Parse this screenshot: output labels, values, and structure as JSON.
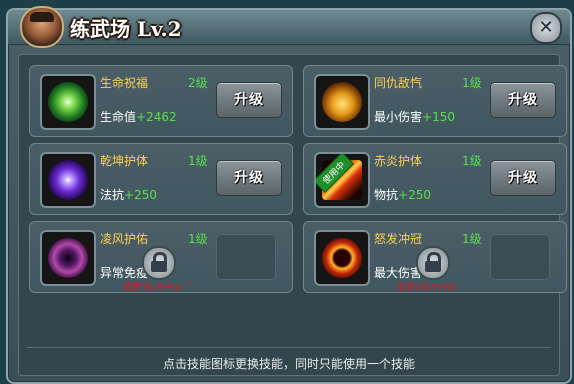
{
  "title": "练武场 Lv.2",
  "close_icon_glyph": "✕",
  "skills": [
    {
      "name": "生命祝福",
      "level": "2级",
      "stat_label": "生命值",
      "stat_bonus": "+2462",
      "button": "升级",
      "icon": "green-lotus-icon"
    },
    {
      "name": "同仇敌忾",
      "level": "1级",
      "stat_label": "最小伤害",
      "stat_bonus": "+150",
      "button": "升级",
      "icon": "golden-dragon-icon"
    },
    {
      "name": "乾坤护体",
      "level": "1级",
      "stat_label": "法抗",
      "stat_bonus": "+250",
      "button": "升级",
      "icon": "purple-vortex-icon"
    },
    {
      "name": "赤炎护体",
      "level": "1级",
      "stat_label": "物抗",
      "stat_bonus": "+250",
      "button": "升级",
      "icon": "fire-sword-icon",
      "badge": "使用中"
    },
    {
      "name": "凌风护佑",
      "level": "1级",
      "stat_label": "异常免疫",
      "stat_bonus": "",
      "locked": true,
      "unlock_text": "需要3级才开启",
      "icon": "dark-vortex-icon"
    },
    {
      "name": "怒发冲冠",
      "level": "1级",
      "stat_label": "最大伤害",
      "stat_bonus": "",
      "locked": true,
      "unlock_text": "需要3级才开启",
      "icon": "red-burst-icon"
    }
  ],
  "footer_text": "点击技能图标更换技能，同时只能使用一个技能",
  "colors": {
    "skill_name": "#ffcf4d",
    "level": "#58e04c",
    "bonus": "#58e04c",
    "lock_text": "#c3202a",
    "badge": "#1f8f2a"
  }
}
